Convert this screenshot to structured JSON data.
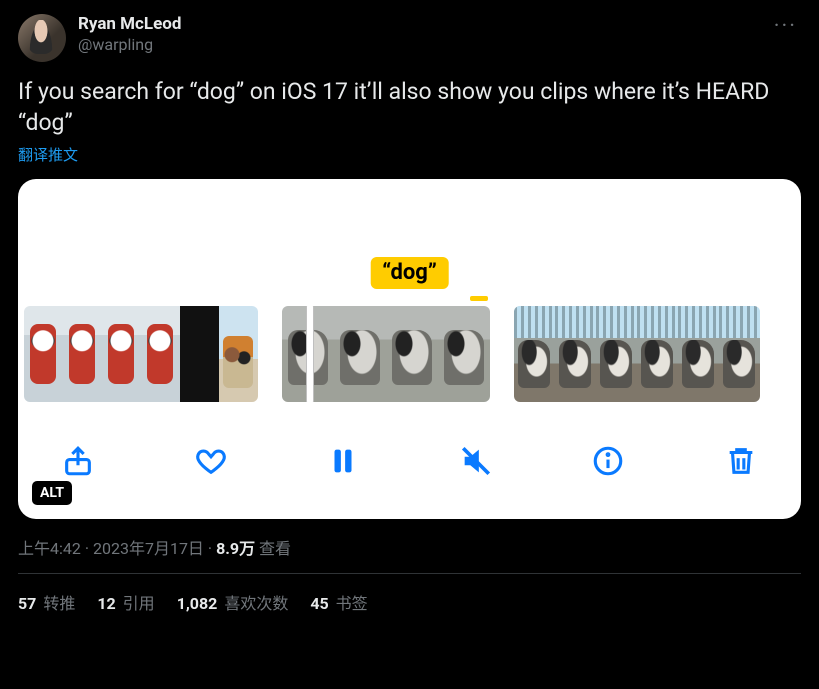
{
  "author": {
    "display_name": "Ryan McLeod",
    "handle": "@warpling"
  },
  "tweet_text": "If you search for “dog” on iOS 17 it’ll also show you clips where it’s HEARD “dog”",
  "translate_label": "翻译推文",
  "media": {
    "search_highlight": "“dog”",
    "alt_badge": "ALT",
    "toolbar": {
      "share": "share-icon",
      "like": "heart-icon",
      "playpause": "pause-icon",
      "mute": "mute-icon",
      "info": "info-icon",
      "delete": "trash-icon"
    }
  },
  "meta": {
    "time": "上午4:42",
    "separator": " · ",
    "date": "2023年7月17日",
    "views_count": "8.9万",
    "views_label": " 查看"
  },
  "stats": {
    "retweets": {
      "count": "57",
      "label": " 转推"
    },
    "quotes": {
      "count": "12",
      "label": " 引用"
    },
    "likes": {
      "count": "1,082",
      "label": " 喜欢次数"
    },
    "bookmarks": {
      "count": "45",
      "label": " 书签"
    }
  }
}
